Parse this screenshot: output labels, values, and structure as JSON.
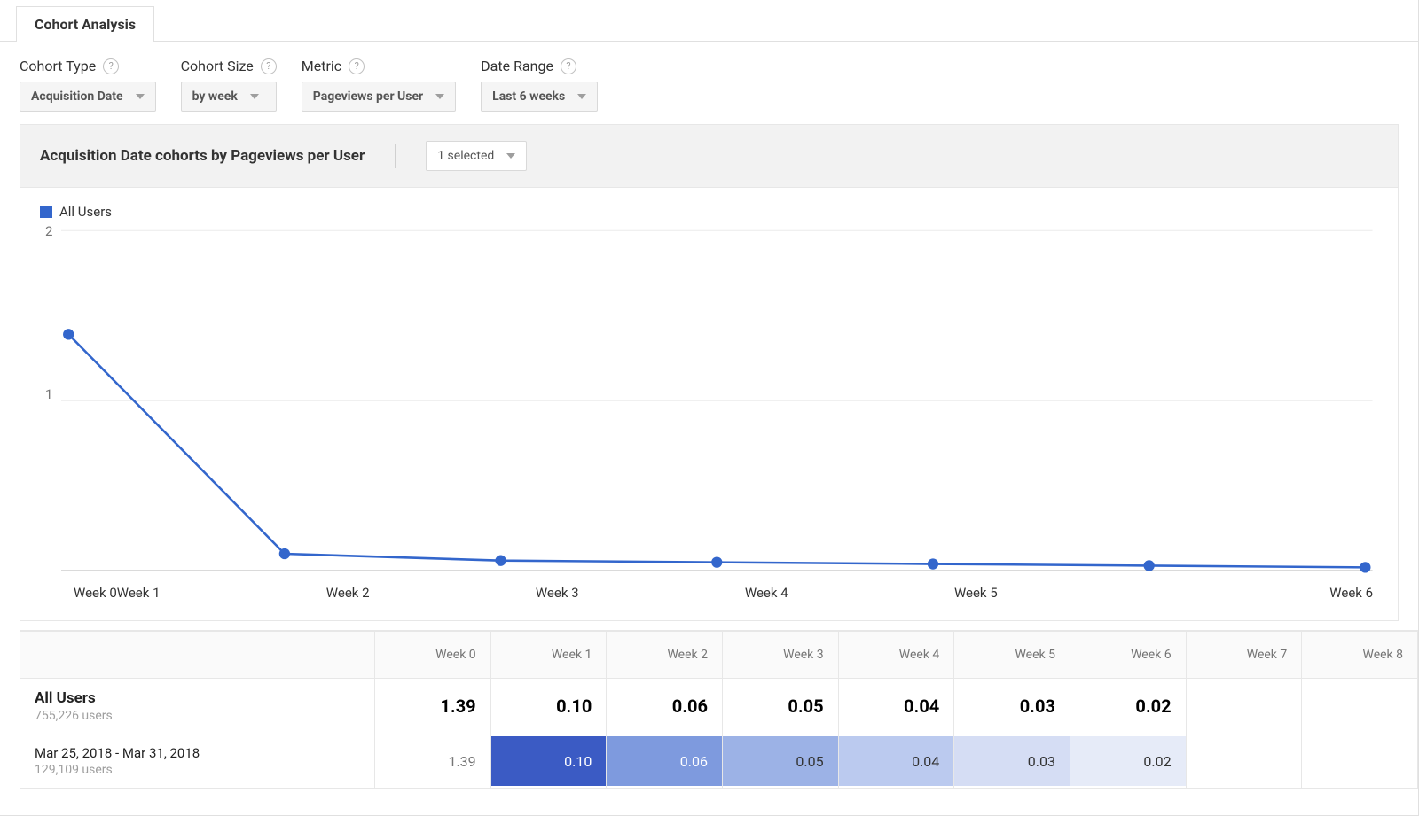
{
  "tab": {
    "label": "Cohort Analysis"
  },
  "controls": {
    "cohort_type": {
      "label": "Cohort Type",
      "value": "Acquisition Date"
    },
    "cohort_size": {
      "label": "Cohort Size",
      "value": "by week"
    },
    "metric": {
      "label": "Metric",
      "value": "Pageviews per User"
    },
    "date_range": {
      "label": "Date Range",
      "value": "Last 6 weeks"
    }
  },
  "panel": {
    "title": "Acquisition Date cohorts by Pageviews per User",
    "selector_value": "1 selected"
  },
  "legend": {
    "label": "All Users",
    "color": "#3366cc"
  },
  "chart_data": {
    "type": "line",
    "title": "",
    "xlabel": "",
    "ylabel": "",
    "ylim": [
      0,
      2
    ],
    "y_ticks": [
      2,
      1
    ],
    "categories": [
      "Week 0",
      "Week 1",
      "Week 2",
      "Week 3",
      "Week 4",
      "Week 5",
      "Week 6"
    ],
    "series": [
      {
        "name": "All Users",
        "color": "#3366cc",
        "values": [
          1.39,
          0.1,
          0.06,
          0.05,
          0.04,
          0.03,
          0.02
        ]
      }
    ]
  },
  "table": {
    "columns": [
      "Week 0",
      "Week 1",
      "Week 2",
      "Week 3",
      "Week 4",
      "Week 5",
      "Week 6",
      "Week 7",
      "Week 8"
    ],
    "rows": [
      {
        "title": "All Users",
        "subtitle": "755,226 users",
        "bold": true,
        "cells": [
          {
            "v": "1.39"
          },
          {
            "v": "0.10"
          },
          {
            "v": "0.06"
          },
          {
            "v": "0.05"
          },
          {
            "v": "0.04"
          },
          {
            "v": "0.03"
          },
          {
            "v": "0.02"
          },
          {
            "v": ""
          },
          {
            "v": ""
          }
        ]
      },
      {
        "title": "Mar 25, 2018 - Mar 31, 2018",
        "subtitle": "129,109 users",
        "bold": false,
        "cells": [
          {
            "v": "1.39"
          },
          {
            "v": "0.10",
            "bg": "#3b5bc4",
            "fg": "#fff"
          },
          {
            "v": "0.06",
            "bg": "#7e9ade",
            "fg": "#fff"
          },
          {
            "v": "0.05",
            "bg": "#9cb2e6"
          },
          {
            "v": "0.04",
            "bg": "#bbcaef"
          },
          {
            "v": "0.03",
            "bg": "#d5ddf4"
          },
          {
            "v": "0.02",
            "bg": "#e6ebf8"
          },
          {
            "v": ""
          },
          {
            "v": ""
          }
        ]
      }
    ]
  }
}
